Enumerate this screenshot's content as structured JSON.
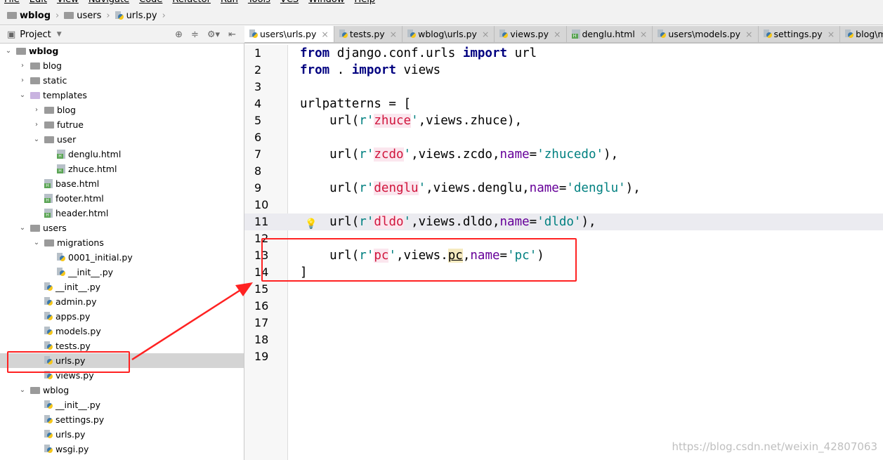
{
  "menu": [
    "File",
    "Edit",
    "View",
    "Navigate",
    "Code",
    "Refactor",
    "Run",
    "Tools",
    "VCS",
    "Window",
    "Help"
  ],
  "breadcrumb": [
    "wblog",
    "users",
    "urls.py"
  ],
  "project": {
    "label": "Project"
  },
  "tree": [
    {
      "label": "wblog",
      "depth": 0,
      "type": "folder",
      "state": "open",
      "bold": true
    },
    {
      "label": "blog",
      "depth": 1,
      "type": "folder",
      "state": "closed"
    },
    {
      "label": "static",
      "depth": 1,
      "type": "folder",
      "state": "closed"
    },
    {
      "label": "templates",
      "depth": 1,
      "type": "folder-purple",
      "state": "open"
    },
    {
      "label": "blog",
      "depth": 2,
      "type": "folder",
      "state": "closed"
    },
    {
      "label": "futrue",
      "depth": 2,
      "type": "folder",
      "state": "closed"
    },
    {
      "label": "user",
      "depth": 2,
      "type": "folder",
      "state": "open"
    },
    {
      "label": "denglu.html",
      "depth": 3,
      "type": "html"
    },
    {
      "label": "zhuce.html",
      "depth": 3,
      "type": "html"
    },
    {
      "label": "base.html",
      "depth": 2,
      "type": "html"
    },
    {
      "label": "footer.html",
      "depth": 2,
      "type": "html"
    },
    {
      "label": "header.html",
      "depth": 2,
      "type": "html"
    },
    {
      "label": "users",
      "depth": 1,
      "type": "folder",
      "state": "open"
    },
    {
      "label": "migrations",
      "depth": 2,
      "type": "folder",
      "state": "open"
    },
    {
      "label": "0001_initial.py",
      "depth": 3,
      "type": "py"
    },
    {
      "label": "__init__.py",
      "depth": 3,
      "type": "py"
    },
    {
      "label": "__init__.py",
      "depth": 2,
      "type": "py"
    },
    {
      "label": "admin.py",
      "depth": 2,
      "type": "py"
    },
    {
      "label": "apps.py",
      "depth": 2,
      "type": "py"
    },
    {
      "label": "models.py",
      "depth": 2,
      "type": "py"
    },
    {
      "label": "tests.py",
      "depth": 2,
      "type": "py"
    },
    {
      "label": "urls.py",
      "depth": 2,
      "type": "py",
      "selected": true
    },
    {
      "label": "views.py",
      "depth": 2,
      "type": "py"
    },
    {
      "label": "wblog",
      "depth": 1,
      "type": "folder",
      "state": "open"
    },
    {
      "label": "__init__.py",
      "depth": 2,
      "type": "py"
    },
    {
      "label": "settings.py",
      "depth": 2,
      "type": "py"
    },
    {
      "label": "urls.py",
      "depth": 2,
      "type": "py"
    },
    {
      "label": "wsgi.py",
      "depth": 2,
      "type": "py"
    }
  ],
  "tabs": [
    {
      "label": "users\\urls.py",
      "type": "py",
      "active": true
    },
    {
      "label": "tests.py",
      "type": "py"
    },
    {
      "label": "wblog\\urls.py",
      "type": "py"
    },
    {
      "label": "views.py",
      "type": "py"
    },
    {
      "label": "denglu.html",
      "type": "html"
    },
    {
      "label": "users\\models.py",
      "type": "py"
    },
    {
      "label": "settings.py",
      "type": "py"
    },
    {
      "label": "blog\\models",
      "type": "py"
    }
  ],
  "code": [
    [
      [
        "from",
        "kw"
      ],
      [
        " django.conf.urls ",
        ""
      ],
      [
        "import",
        "kw"
      ],
      [
        " url",
        ""
      ]
    ],
    [
      [
        "from",
        "kw"
      ],
      [
        " . ",
        ""
      ],
      [
        "import",
        "kw"
      ],
      [
        " views",
        ""
      ]
    ],
    [],
    [
      [
        "urlpatterns = [",
        ""
      ]
    ],
    [
      [
        "    url(",
        ""
      ],
      [
        "r'",
        "q"
      ],
      [
        "zhuce",
        "re"
      ],
      [
        "'",
        "q"
      ],
      [
        ",views.zhuce),",
        ""
      ]
    ],
    [],
    [
      [
        "    url(",
        ""
      ],
      [
        "r'",
        "q"
      ],
      [
        "zcdo",
        "re"
      ],
      [
        "'",
        "q"
      ],
      [
        ",views.zcdo,",
        ""
      ],
      [
        "name",
        "kwarg"
      ],
      [
        "=",
        ""
      ],
      [
        "'zhucedo'",
        "st"
      ],
      [
        "),",
        ""
      ]
    ],
    [],
    [
      [
        "    url(",
        ""
      ],
      [
        "r'",
        "q"
      ],
      [
        "denglu",
        "re"
      ],
      [
        "'",
        "q"
      ],
      [
        ",views.denglu,",
        ""
      ],
      [
        "name",
        "kwarg"
      ],
      [
        "=",
        ""
      ],
      [
        "'denglu'",
        "st"
      ],
      [
        "),",
        ""
      ]
    ],
    [],
    [
      [
        "    url(",
        ""
      ],
      [
        "r'",
        "q"
      ],
      [
        "dldo",
        "re"
      ],
      [
        "'",
        "q"
      ],
      [
        ",views.dldo,",
        ""
      ],
      [
        "name",
        "kwarg"
      ],
      [
        "=",
        ""
      ],
      [
        "'dldo'",
        "st"
      ],
      [
        "),",
        ""
      ]
    ],
    [],
    [
      [
        "    url(",
        ""
      ],
      [
        "r'",
        "q"
      ],
      [
        "pc",
        "re"
      ],
      [
        "'",
        "q"
      ],
      [
        ",views.",
        ""
      ],
      [
        "pc",
        "hl"
      ],
      [
        ",",
        ""
      ],
      [
        "name",
        "kwarg"
      ],
      [
        "=",
        ""
      ],
      [
        "'pc'",
        "st"
      ],
      [
        ")",
        ""
      ]
    ],
    [
      [
        "]",
        ""
      ]
    ],
    [],
    [],
    [],
    [],
    []
  ],
  "current_line": 11,
  "watermark": "https://blog.csdn.net/weixin_42807063"
}
